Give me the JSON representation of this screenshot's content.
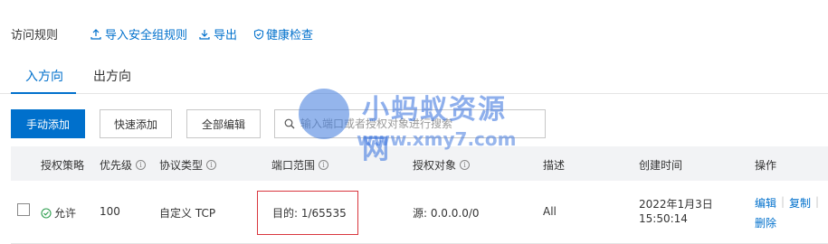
{
  "header": {
    "title": "访问规则",
    "links": [
      {
        "label": "导入安全组规则",
        "icon": "upload-icon"
      },
      {
        "label": "导出",
        "icon": "download-icon"
      },
      {
        "label": "健康检查",
        "icon": "check-shield-icon"
      }
    ]
  },
  "tabs": [
    {
      "label": "入方向",
      "active": true
    },
    {
      "label": "出方向",
      "active": false
    }
  ],
  "toolbar": {
    "manual_add": "手动添加",
    "quick_add": "快速添加",
    "edit_all": "全部编辑",
    "search_placeholder": "输入端口或者授权对象进行搜索"
  },
  "table": {
    "columns": [
      "授权策略",
      "优先级",
      "协议类型",
      "端口范围",
      "授权对象",
      "描述",
      "创建时间",
      "操作"
    ],
    "rows": [
      {
        "policy": "允许",
        "priority": "100",
        "protocol": "自定义 TCP",
        "port_range": "目的: 1/65535",
        "auth_object": "源: 0.0.0.0/0",
        "description": "All",
        "created_date": "2022年1月3日",
        "created_time": "15:50:14",
        "actions": {
          "edit": "编辑",
          "copy": "复制",
          "delete": "删除",
          "separator": "|"
        }
      }
    ]
  },
  "watermark": {
    "title": "小蚂蚁资源网",
    "url": "www.xmy7.com"
  },
  "colors": {
    "accent": "#0070cc",
    "highlight": "#d9363e",
    "header_bg": "#f2f3f5",
    "allow_green": "#2e9e4f"
  }
}
